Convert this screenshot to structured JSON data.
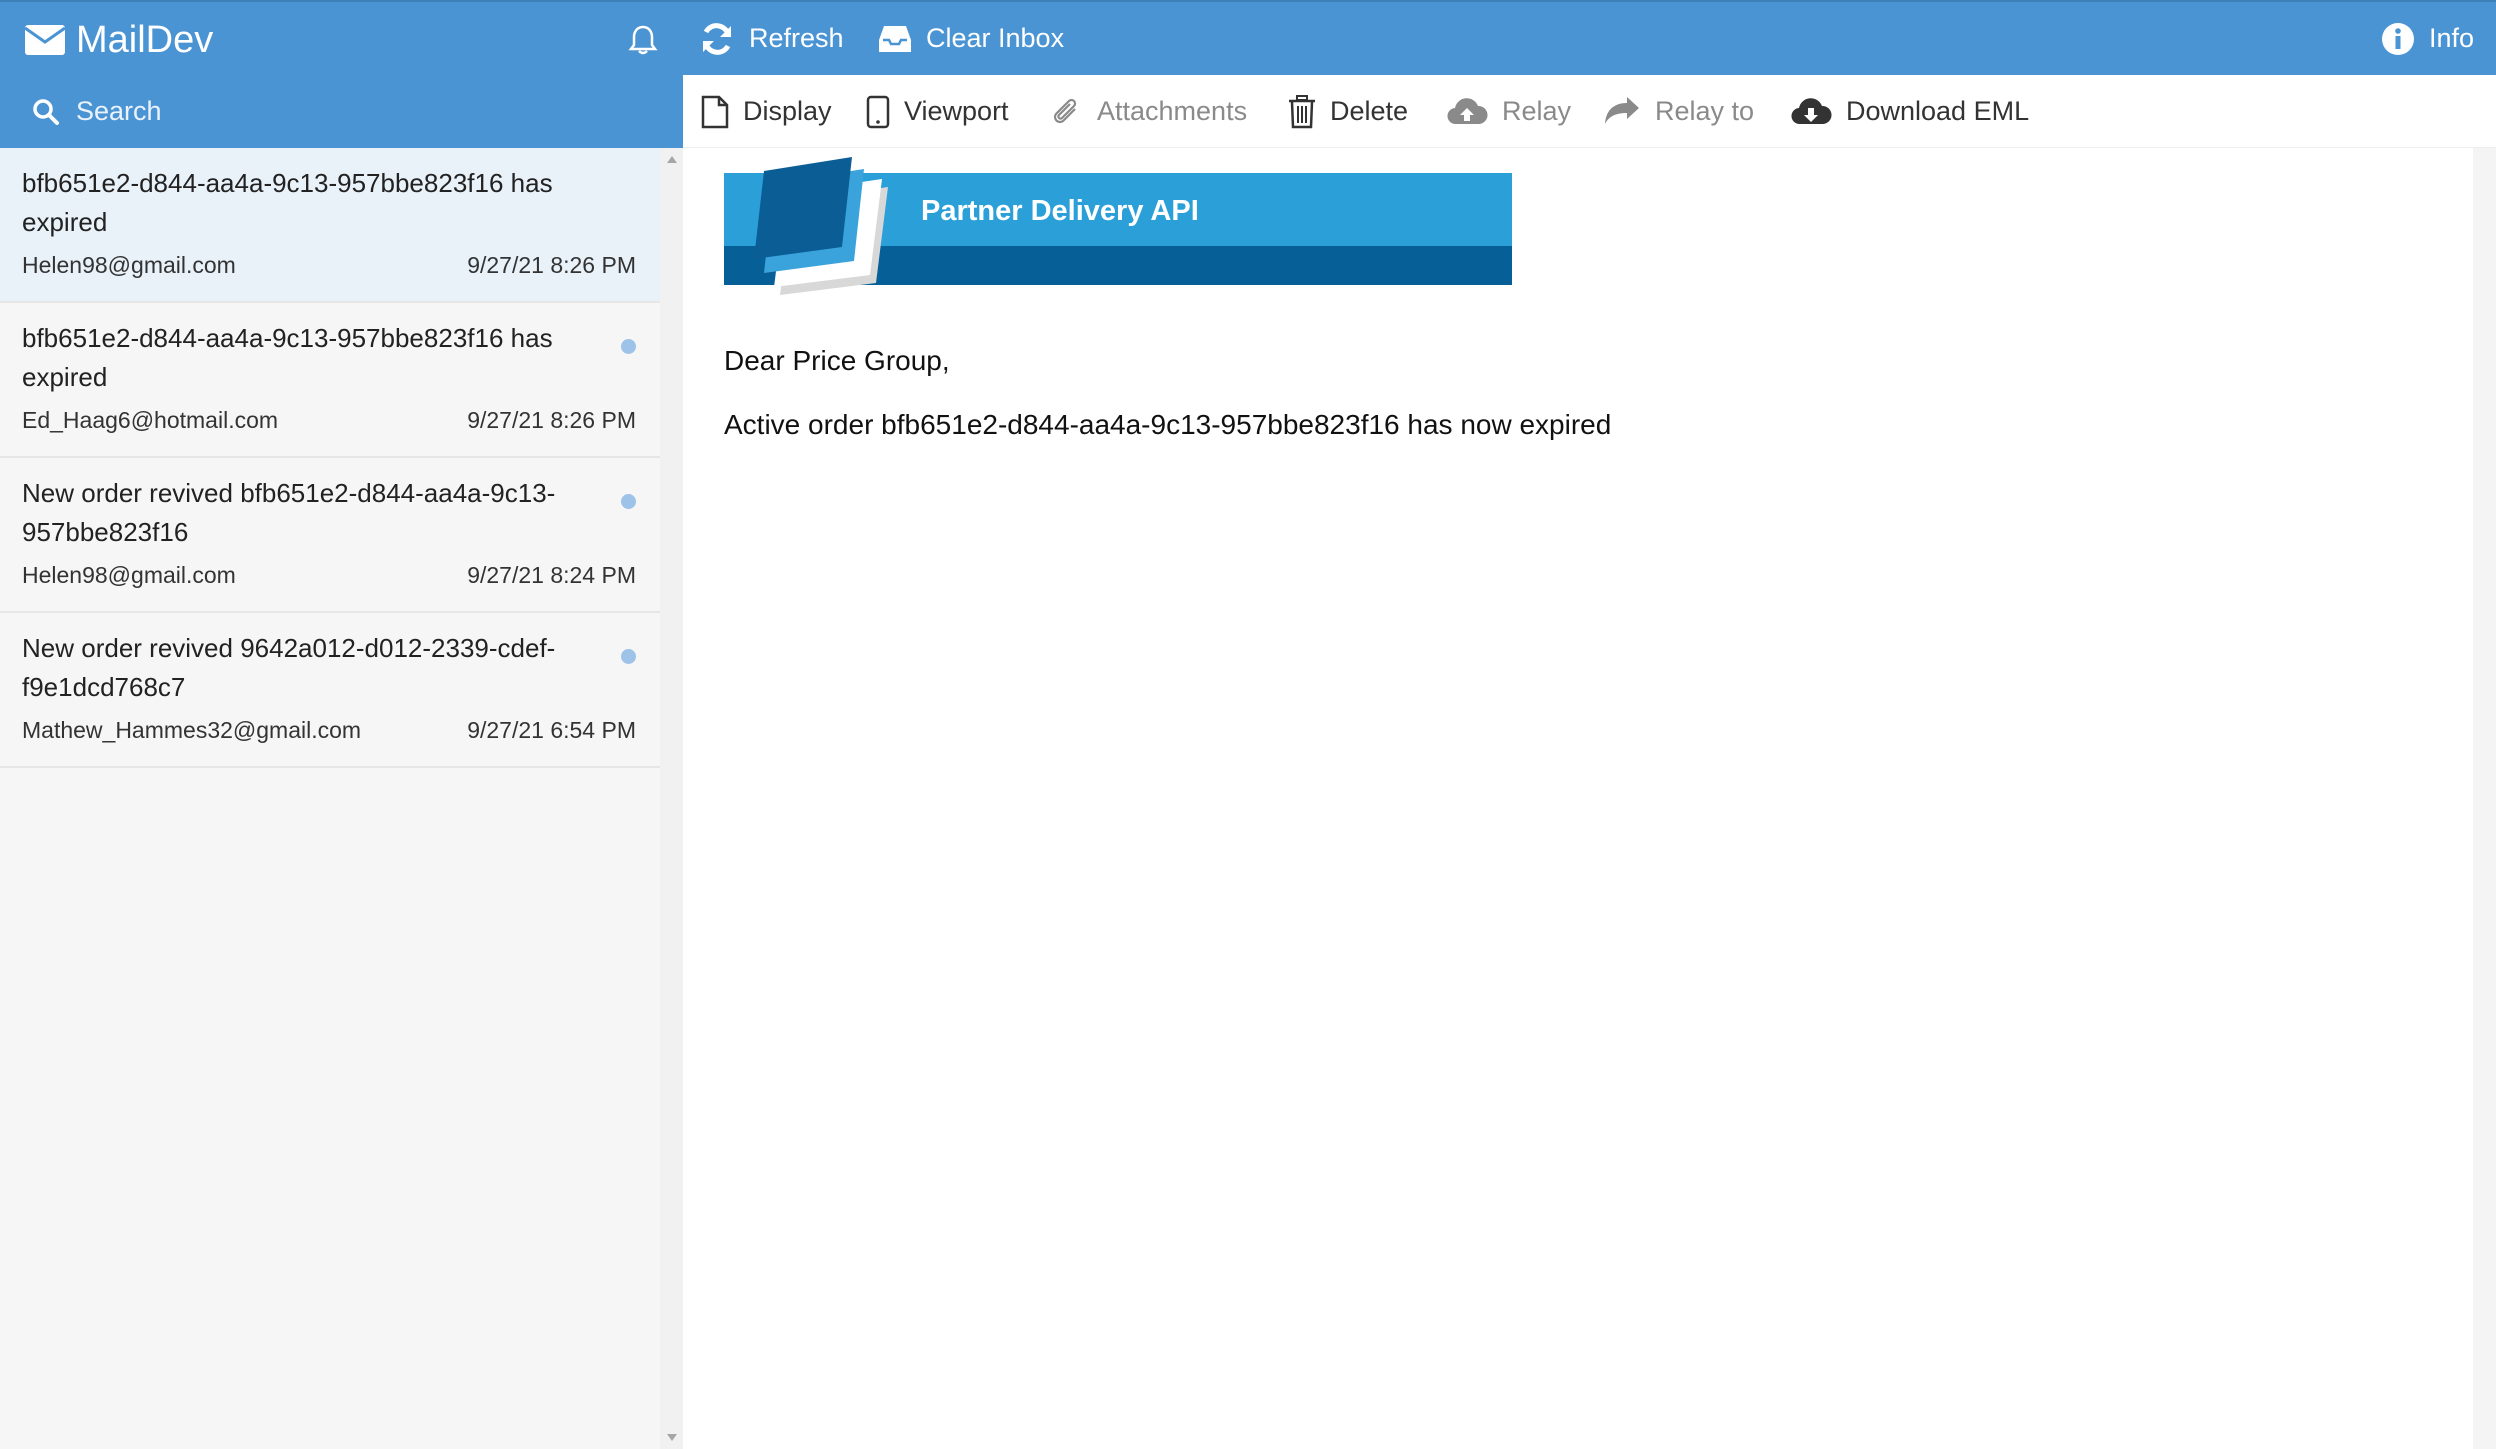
{
  "app": {
    "name": "MailDev",
    "accent_color": "#4b94d4"
  },
  "topbar": {
    "refresh_label": "Refresh",
    "clear_inbox_label": "Clear Inbox",
    "info_label": "Info"
  },
  "search": {
    "placeholder": "Search"
  },
  "messages": [
    {
      "subject": "bfb651e2-d844-aa4a-9c13-957bbe823f16 has expired",
      "from": "Helen98@gmail.com",
      "date": "9/27/21 8:26 PM",
      "unread": false,
      "selected": true
    },
    {
      "subject": "bfb651e2-d844-aa4a-9c13-957bbe823f16 has expired",
      "from": "Ed_Haag6@hotmail.com",
      "date": "9/27/21 8:26 PM",
      "unread": true,
      "selected": false
    },
    {
      "subject": "New order revived bfb651e2-d844-aa4a-9c13-957bbe823f16",
      "from": "Helen98@gmail.com",
      "date": "9/27/21 8:24 PM",
      "unread": true,
      "selected": false
    },
    {
      "subject": "New order revived 9642a012-d012-2339-cdef-f9e1dcd768c7",
      "from": "Mathew_Hammes32@gmail.com",
      "date": "9/27/21 6:54 PM",
      "unread": true,
      "selected": false
    }
  ],
  "content_toolbar": {
    "display_label": "Display",
    "viewport_label": "Viewport",
    "attachments_label": "Attachments",
    "delete_label": "Delete",
    "relay_label": "Relay",
    "relay_to_label": "Relay to",
    "download_label": "Download EML"
  },
  "email": {
    "banner_title": "Partner Delivery API",
    "greeting": "Dear Price Group,",
    "body": "Active order bfb651e2-d844-aa4a-9c13-957bbe823f16 has now expired"
  }
}
